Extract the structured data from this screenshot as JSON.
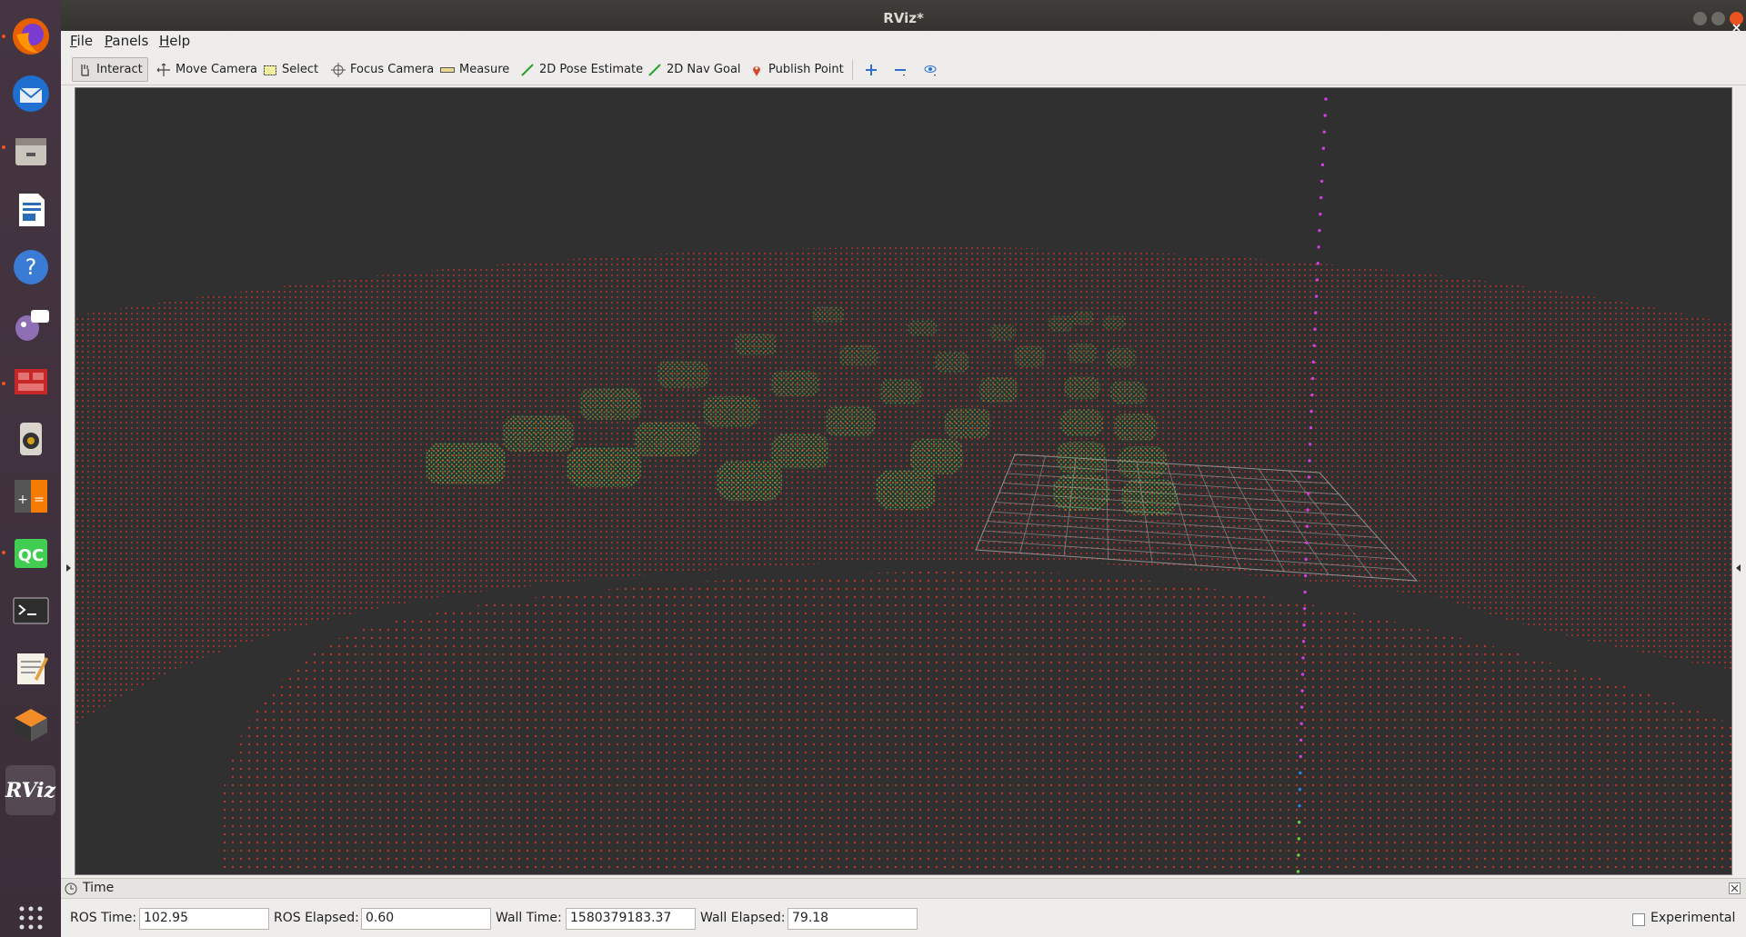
{
  "window": {
    "title": "RViz*"
  },
  "menu": [
    {
      "label": "File",
      "accel": "F",
      "rest": "ile"
    },
    {
      "label": "Panels",
      "accel": "P",
      "rest": "anels"
    },
    {
      "label": "Help",
      "accel": "H",
      "rest": "elp"
    }
  ],
  "toolbar": {
    "tools": [
      {
        "label": "Interact",
        "icon": "hand-icon",
        "active": true
      },
      {
        "label": "Move Camera",
        "icon": "move-camera-icon"
      },
      {
        "label": "Select",
        "icon": "select-icon"
      },
      {
        "label": "Focus Camera",
        "icon": "focus-camera-icon"
      },
      {
        "label": "Measure",
        "icon": "ruler-icon"
      },
      {
        "label": "2D Pose Estimate",
        "icon": "green-arrow-icon"
      },
      {
        "label": "2D Nav Goal",
        "icon": "green-arrow-icon"
      },
      {
        "label": "Publish Point",
        "icon": "map-pin-icon"
      }
    ]
  },
  "dock": {
    "apps": [
      "firefox-icon",
      "thunderbird-icon",
      "files-icon",
      "writer-icon",
      "help-icon",
      "pidgin-icon",
      "screen-icon",
      "speaker-icon",
      "calculator-icon",
      "qt-creator-icon",
      "terminal-icon",
      "text-editor-icon",
      "package-icon",
      "rviz-icon"
    ],
    "qc_label": "QC",
    "rviz_label": "RViz",
    "calc_label": "+ =",
    "terminal_label": ">_"
  },
  "colors": {
    "viewport_bg": "#303030",
    "ground_points": "#c8372b",
    "grid": "#a0a0a0",
    "trajectory": "#d040e0"
  },
  "time_panel": {
    "title": "Time",
    "ros_time_label": "ROS Time:",
    "ros_time": "102.95",
    "ros_elapsed_label": "ROS Elapsed:",
    "ros_elapsed": "0.60",
    "wall_time_label": "Wall Time:",
    "wall_time": "1580379183.37",
    "wall_elapsed_label": "Wall Elapsed:",
    "wall_elapsed": "79.18",
    "experimental_label": "Experimental",
    "experimental": false
  }
}
